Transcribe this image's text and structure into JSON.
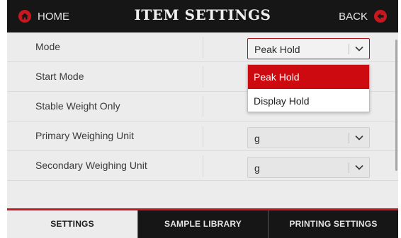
{
  "header": {
    "home_label": "HOME",
    "title": "ITEM SETTINGS",
    "back_label": "BACK"
  },
  "rows": [
    {
      "label": "Mode",
      "value": "Peak Hold"
    },
    {
      "label": "Start Mode"
    },
    {
      "label": "Stable Weight Only"
    },
    {
      "label": "Primary Weighing Unit",
      "value": "g"
    },
    {
      "label": "Secondary Weighing Unit",
      "value": "g"
    }
  ],
  "dropdown": {
    "options": [
      "Peak Hold",
      "Display Hold"
    ],
    "selected": "Peak Hold"
  },
  "tabs": [
    {
      "label": "SETTINGS",
      "active": true
    },
    {
      "label": "SAMPLE LIBRARY",
      "active": false
    },
    {
      "label": "PRINTING SETTINGS",
      "active": false
    }
  ],
  "colors": {
    "accent": "#cc0a10",
    "header_bg": "#161616",
    "body_bg": "#ececec"
  }
}
